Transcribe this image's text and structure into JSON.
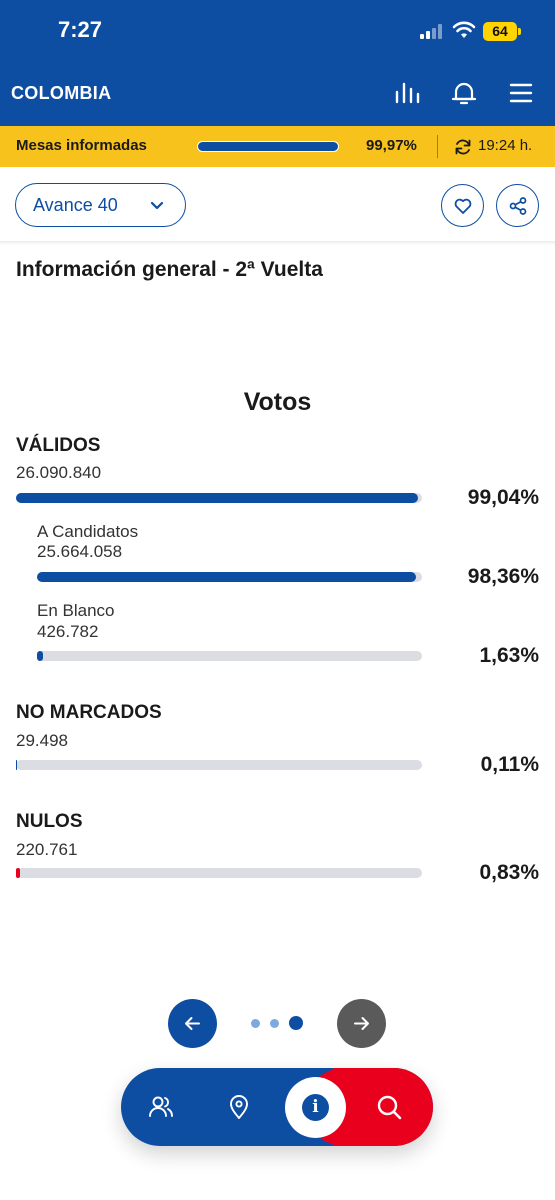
{
  "status_bar": {
    "time": "7:27",
    "battery": "64"
  },
  "header": {
    "title": "COLOMBIA",
    "icons": [
      "bar-chart-icon",
      "bell-icon",
      "menu-icon"
    ]
  },
  "mesas": {
    "label": "Mesas informadas",
    "progress": 0.9997,
    "percent": "99,97%",
    "time": "19:24 h."
  },
  "controls": {
    "avance_label": "Avance 40",
    "icons": [
      "heart-icon",
      "share-icon"
    ]
  },
  "section_title": "Información general - 2ª Vuelta",
  "votos_title": "Votos",
  "rows": {
    "validos": {
      "label": "VÁLIDOS",
      "value": "26.090.840",
      "percent": "99,04%",
      "fraction": 0.9904
    },
    "candidatos": {
      "label": "A Candidatos",
      "value": "25.664.058",
      "percent": "98,36%",
      "fraction": 0.9836
    },
    "blanco": {
      "label": "En Blanco",
      "value": "426.782",
      "percent": "1,63%",
      "fraction": 0.0163
    },
    "no_marcados": {
      "label": "NO MARCADOS",
      "value": "29.498",
      "percent": "0,11%",
      "fraction": 0.0011
    },
    "nulos": {
      "label": "NULOS",
      "value": "220.761",
      "percent": "0,83%",
      "fraction": 0.0083
    }
  },
  "pager": {
    "pages": 3,
    "current_page": 3
  },
  "bottom_nav": {
    "items": [
      "people-icon",
      "location-pin-icon",
      "info-icon",
      "search-icon"
    ],
    "active": "info-icon"
  },
  "colors": {
    "brand_blue": "#0d4ea3",
    "accent_yellow": "#f7c21b",
    "accent_red": "#e8001c",
    "track_gray": "#dcdde3"
  }
}
